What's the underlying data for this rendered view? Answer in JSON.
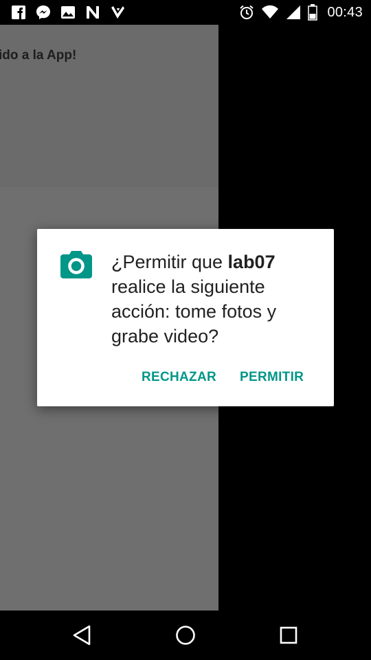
{
  "status_bar": {
    "time": "00:43",
    "left_icons": [
      "facebook-icon",
      "messenger-icon",
      "gallery-icon",
      "n-app-icon",
      "checkmark-app-icon"
    ],
    "right_icons": [
      "alarm-icon",
      "wifi-icon",
      "signal-icon",
      "battery-icon"
    ]
  },
  "app": {
    "welcome_text": "ido a la App!"
  },
  "dialog": {
    "icon": "camera-icon",
    "message_prefix": "¿Permitir que ",
    "app_name": "lab07",
    "message_suffix": " realice la siguiente acción: tome fotos y grabe video?",
    "deny_label": "RECHAZAR",
    "allow_label": "PERMITIR",
    "accent_color": "#009688"
  },
  "nav_bar": {
    "icons": [
      "back-icon",
      "home-icon",
      "recents-icon"
    ]
  }
}
